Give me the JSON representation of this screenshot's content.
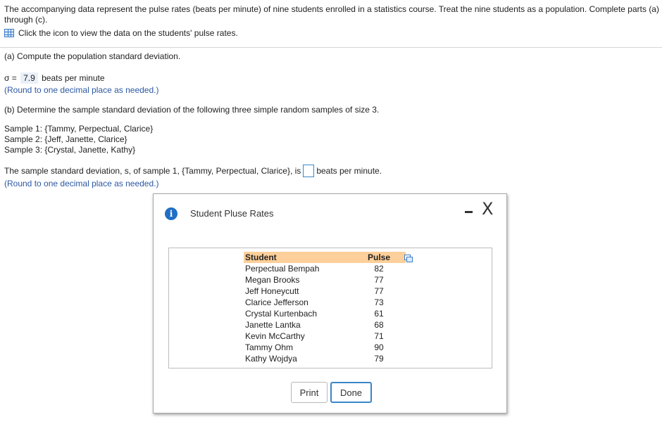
{
  "intro": "The accompanying data represent the pulse rates (beats per minute) of nine students enrolled in a statistics course. Treat the nine students as a population. Complete parts (a) through (c).",
  "data_link": "Click the icon to view the data on the students' pulse rates.",
  "part_a": {
    "heading": "(a) Compute the population standard deviation.",
    "sigma_label": "σ =",
    "sigma_value": "7.9",
    "unit": "beats per minute",
    "hint": "(Round to one decimal place as needed.)"
  },
  "part_b": {
    "heading": "(b) Determine the sample standard deviation of the following three simple random samples of size 3.",
    "samples": [
      "Sample 1: {Tammy, Perpectual, Clarice}",
      "Sample 2: {Jeff, Janette, Clarice}",
      "Sample 3: {Crystal, Janette, Kathy}"
    ],
    "question_prefix": "The sample standard deviation, s, of sample 1, {Tammy, Perpectual, Clarice}, is",
    "answer_value": "",
    "question_suffix": "beats per minute.",
    "hint": "(Round to one decimal place as needed.)"
  },
  "dialog": {
    "title": "Student Pluse Rates",
    "info_icon": "i",
    "close_label": "X",
    "table": {
      "headers": [
        "Student",
        "Pulse"
      ],
      "rows": [
        [
          "Perpectual Bempah",
          "82"
        ],
        [
          "Megan Brooks",
          "77"
        ],
        [
          "Jeff Honeycutt",
          "77"
        ],
        [
          "Clarice Jefferson",
          "73"
        ],
        [
          "Crystal Kurtenbach",
          "61"
        ],
        [
          "Janette Lantka",
          "68"
        ],
        [
          "Kevin McCarthy",
          "71"
        ],
        [
          "Tammy Ohm",
          "90"
        ],
        [
          "Kathy Wojdya",
          "79"
        ]
      ]
    },
    "print_label": "Print",
    "done_label": "Done"
  }
}
